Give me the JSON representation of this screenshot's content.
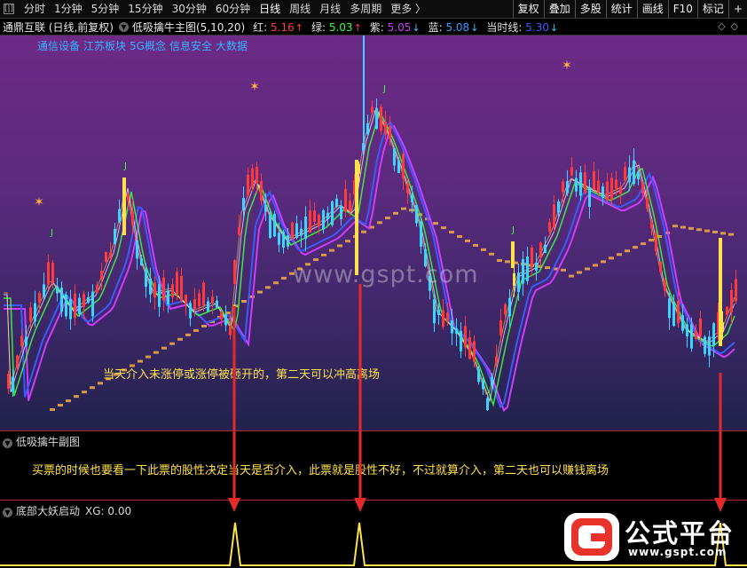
{
  "toolbar": {
    "toggle_icon": "[|]",
    "periods": [
      "分时",
      "1分钟",
      "5分钟",
      "15分钟",
      "30分钟",
      "60分钟",
      "日线",
      "周线",
      "月线",
      "多周期",
      "更多 〉"
    ],
    "active_period": "日线",
    "buttons": [
      "复权",
      "叠加",
      "多股",
      "统计",
      "画线",
      "F10",
      "标记",
      "+"
    ]
  },
  "info_row": {
    "stock_name": "通鼎互联 (日线,前复权)",
    "indicator_name": "低吸擒牛主图(5,10,20)",
    "ma_values": [
      {
        "label": "红:",
        "value": "5.16",
        "arrow": "↑",
        "color": "#ff3b3b",
        "dir": "up"
      },
      {
        "label": "绿:",
        "value": "5.03",
        "arrow": "↑",
        "color": "#3bff3b",
        "dir": "up"
      },
      {
        "label": "紫:",
        "value": "5.05",
        "arrow": "↓",
        "color": "#d03bff",
        "dir": "down"
      },
      {
        "label": "蓝:",
        "value": "5.08",
        "arrow": "↓",
        "color": "#3b9bff",
        "dir": "down"
      },
      {
        "label": "当时线:",
        "value": "5.30",
        "arrow": "↓",
        "color": "#3b5bff",
        "dir": "down"
      }
    ],
    "right_icons": "◇◇"
  },
  "concept_tags": [
    "通信设备",
    "江苏板块",
    "5G概念",
    "信息安全",
    "大数据"
  ],
  "annotations": {
    "main": "当天介入未涨停或涨停被砸开的，第二天可以冲高离场",
    "sub": "买票的时候也要看一下此票的股性决定当天是否介入，此票就是股性不好，不过就算介入，第二天也可以赚钱离场"
  },
  "watermark": "www.gspt.com",
  "signal_labels": [
    "J",
    "J",
    "J",
    "J"
  ],
  "sub_panel_1": {
    "title": "低吸擒牛副图"
  },
  "sub_panel_2": {
    "title": "底部大妖启动",
    "xg_label": "XG: 0.00"
  },
  "logo": {
    "title": "公式平台",
    "url": "www.gspt.com"
  },
  "colors": {
    "up_candle": "#ff3a3a",
    "down_candle": "#3ad6ff",
    "highlight_candle": "#ffe14a",
    "ma_red": "#ff3b3b",
    "ma_green": "#3bff3b",
    "ma_purple": "#d03bff",
    "ma_blue": "#3b5bff",
    "staircase": "#d99a4a",
    "arrow": "#e62a2a",
    "signal": "#ffe14a"
  }
}
